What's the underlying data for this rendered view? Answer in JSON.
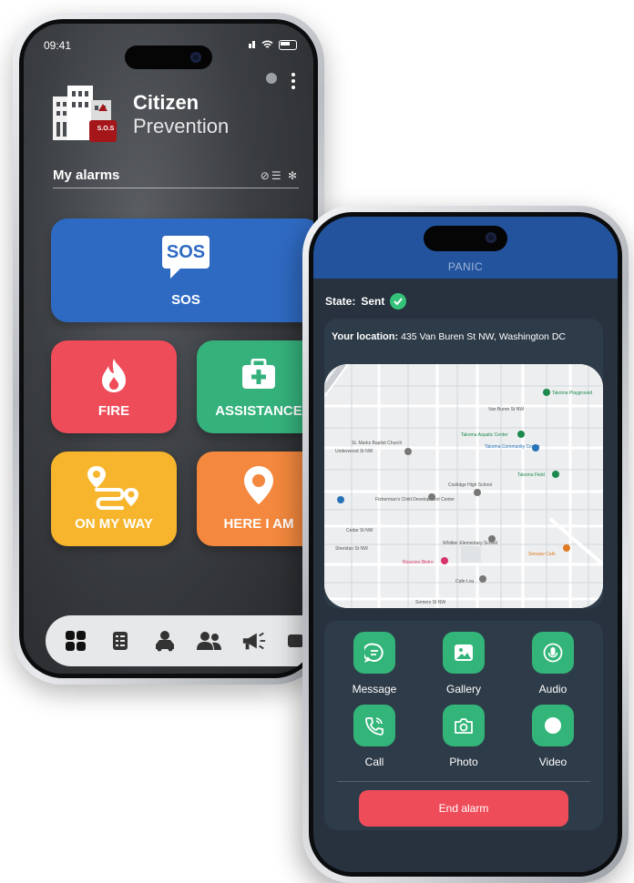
{
  "phone_left": {
    "status_time": "09:41",
    "brand_line1": "Citizen",
    "brand_line2": "Prevention",
    "logo_badge": "S.O.S",
    "section_title": "My alarms",
    "tiles": {
      "sos": "SOS",
      "sos_icon_text": "SOS",
      "fire": "FIRE",
      "assistance": "ASSISTANCE",
      "on_my_way": "ON MY WAY",
      "here_i_am": "HERE I AM"
    },
    "colors": {
      "sos": "#2f6ac2",
      "fire": "#ef4c5a",
      "assistance": "#35b27c",
      "on_my_way": "#f6b52d",
      "here_i_am": "#f3883e"
    },
    "bottom_nav_icons": [
      "grid-icon",
      "list-icon",
      "user-car-icon",
      "group-icon",
      "megaphone-icon",
      "video-icon"
    ]
  },
  "phone_right": {
    "header_title": "PANIC",
    "state_label": "State:",
    "state_value": "Sent",
    "location_label": "Your location:",
    "location_value": "435 Van Buren St NW, Washington DC",
    "map_labels": {
      "playground": "Takoma Playground",
      "van_buren": "Van Buren St NW",
      "aquatic": "Takoma Aquatic Center",
      "st_marks": "St. Marks Baptist Church",
      "underwood": "Underwood St NW",
      "community": "Takoma Community Center",
      "takoma_park": "Takoma Field",
      "coolidge": "Coolidge High School",
      "fishermans": "Fisherman's Child Development Center",
      "cedar": "Cedar St NW",
      "elementary": "Whittier Elementary School",
      "sheridan": "Sheridan St NW",
      "cafe": "Seesaw Cafe",
      "restaurant": "Roscoes Bistro",
      "cafe2": "Cafe Lou",
      "gorham": "Somers St NW"
    },
    "actions": [
      {
        "label": "Message",
        "icon": "message-icon"
      },
      {
        "label": "Gallery",
        "icon": "gallery-icon"
      },
      {
        "label": "Audio",
        "icon": "microphone-icon"
      },
      {
        "label": "Call",
        "icon": "phone-icon"
      },
      {
        "label": "Photo",
        "icon": "camera-icon"
      },
      {
        "label": "Video",
        "icon": "record-icon"
      }
    ],
    "end_button": "End alarm",
    "colors": {
      "header": "#22539c",
      "action": "#33b57a",
      "end": "#ef4c5a",
      "sent": "#35c27a"
    }
  }
}
